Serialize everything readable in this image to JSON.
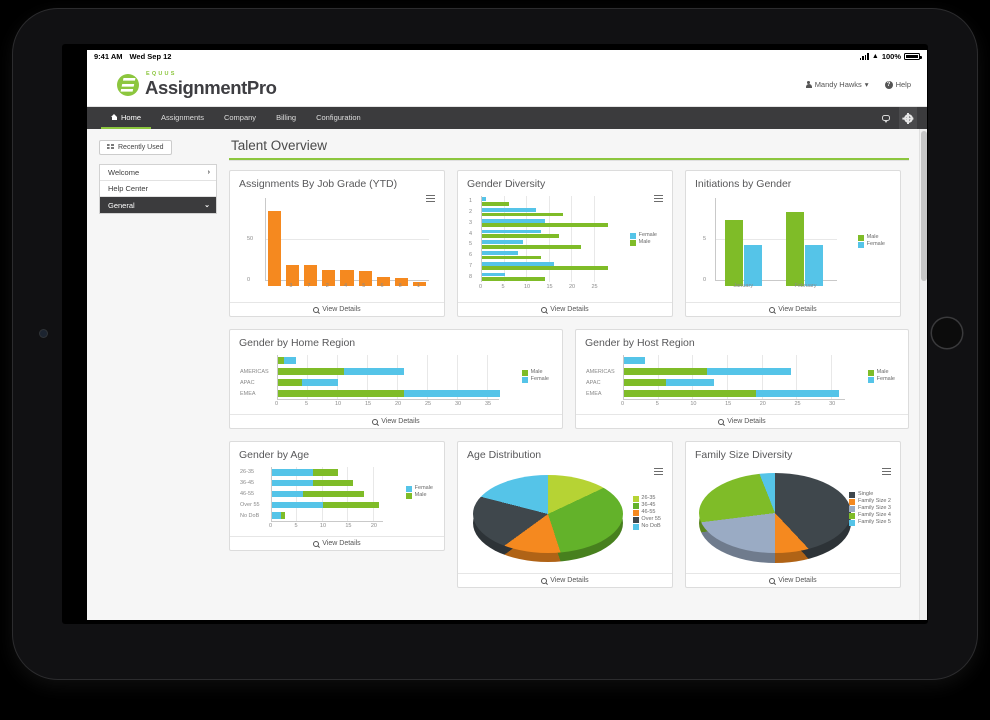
{
  "status_bar": {
    "time": "9:41 AM",
    "date": "Wed Sep 12",
    "battery": "100%"
  },
  "brand": {
    "eyebrow": "EQUUS",
    "name": "AssignmentPro"
  },
  "header": {
    "user": "Mandy Hawks",
    "user_caret": "▾",
    "help": "Help",
    "help_glyph": "?"
  },
  "nav": {
    "items": [
      {
        "label": "Home",
        "active": true
      },
      {
        "label": "Assignments",
        "active": false
      },
      {
        "label": "Company",
        "active": false
      },
      {
        "label": "Billing",
        "active": false
      },
      {
        "label": "Configuration",
        "active": false
      }
    ]
  },
  "sidebar": {
    "recently_used": "Recently Used",
    "items": [
      {
        "label": "Welcome",
        "caret": "›",
        "active": false
      },
      {
        "label": "Help Center",
        "caret": "",
        "active": false
      },
      {
        "label": "General",
        "caret": "⌄",
        "active": true
      }
    ]
  },
  "main": {
    "page_title": "Talent Overview",
    "view_details": "View Details"
  },
  "colors": {
    "green": "#7fbc28",
    "blue": "#55c4e8",
    "orange": "#f5891f",
    "yellow_green": "#b6d334",
    "dark_slate": "#3f474c",
    "steel": "#9aabc4",
    "accent": "#8cc63e",
    "nav_bar": "#3b3b3d"
  },
  "chart_data": [
    {
      "id": "assignments_by_job_grade",
      "type": "bar",
      "title": "Assignments By Job Grade (YTD)",
      "categories": [
        "",
        "3",
        "7",
        "2",
        "4",
        "5",
        "6",
        "8",
        "1"
      ],
      "values": [
        92,
        26,
        26,
        20,
        20,
        18,
        11,
        10,
        5
      ],
      "ylim": [
        0,
        100
      ],
      "yticks": [
        0,
        50
      ],
      "ytick_labels": [
        "0",
        "50"
      ],
      "color": "#f5891f",
      "grid": true
    },
    {
      "id": "gender_diversity",
      "type": "bar",
      "orientation": "horizontal",
      "title": "Gender Diversity",
      "categories": [
        "1",
        "2",
        "3",
        "4",
        "5",
        "6",
        "7",
        "8"
      ],
      "series": [
        {
          "name": "Female",
          "color": "#55c4e8",
          "values": [
            0.8,
            12,
            14,
            13,
            9,
            8,
            16,
            5
          ]
        },
        {
          "name": "Male",
          "color": "#7fbc28",
          "values": [
            6,
            18,
            28,
            17,
            22,
            13,
            28,
            14
          ]
        }
      ],
      "xlim": [
        0,
        28
      ],
      "xticks": [
        0,
        5,
        10,
        15,
        20,
        25
      ],
      "legend_position": "right"
    },
    {
      "id": "initiations_by_gender",
      "type": "bar",
      "title": "Initiations by Gender",
      "categories": [
        "January",
        "February"
      ],
      "series": [
        {
          "name": "Male",
          "color": "#7fbc28",
          "values": [
            8,
            9
          ]
        },
        {
          "name": "Female",
          "color": "#55c4e8",
          "values": [
            5,
            5
          ]
        }
      ],
      "ylim": [
        0,
        10
      ],
      "yticks": [
        0,
        5
      ],
      "ytick_labels": [
        "0",
        "5"
      ],
      "legend_position": "right"
    },
    {
      "id": "gender_by_home_region",
      "type": "bar",
      "orientation": "horizontal",
      "stacked": true,
      "title": "Gender by Home Region",
      "categories": [
        "",
        "AMERICAS",
        "APAC",
        "EMEA"
      ],
      "series": [
        {
          "name": "Male",
          "color": "#7fbc28",
          "values": [
            1,
            11,
            4,
            21
          ]
        },
        {
          "name": "Female",
          "color": "#55c4e8",
          "values": [
            2,
            10,
            6,
            16
          ]
        }
      ],
      "xlim": [
        0,
        37
      ],
      "xticks": [
        0,
        5,
        10,
        15,
        20,
        25,
        30,
        35
      ],
      "legend_position": "right"
    },
    {
      "id": "gender_by_host_region",
      "type": "bar",
      "orientation": "horizontal",
      "stacked": true,
      "title": "Gender by Host Region",
      "categories": [
        "",
        "AMERICAS",
        "APAC",
        "EMEA"
      ],
      "series": [
        {
          "name": "Male",
          "color": "#7fbc28",
          "values": [
            0,
            12,
            6,
            19
          ]
        },
        {
          "name": "Female",
          "color": "#55c4e8",
          "values": [
            3,
            12,
            7,
            12
          ]
        }
      ],
      "xlim": [
        0,
        32
      ],
      "xticks": [
        0,
        5,
        10,
        15,
        20,
        25,
        30
      ],
      "legend_position": "right"
    },
    {
      "id": "gender_by_age",
      "type": "bar",
      "orientation": "horizontal",
      "stacked": true,
      "title": "Gender by Age",
      "categories": [
        "26-35",
        "36-45",
        "46-55",
        "Over 55",
        "No DoB"
      ],
      "series": [
        {
          "name": "Female",
          "color": "#55c4e8",
          "values": [
            8,
            8,
            6,
            10,
            1.8
          ]
        },
        {
          "name": "Male",
          "color": "#7fbc28",
          "values": [
            5,
            8,
            12,
            11,
            0.7
          ]
        }
      ],
      "xlim": [
        0,
        22
      ],
      "xticks": [
        0,
        5,
        10,
        15,
        20
      ],
      "legend_position": "right"
    },
    {
      "id": "age_distribution",
      "type": "pie",
      "title": "Age Distribution",
      "labels": [
        "26-35",
        "36-45",
        "46-55",
        "Over 55",
        "No DoB"
      ],
      "values": [
        18,
        27,
        20,
        14,
        21
      ],
      "colors": [
        "#b6d334",
        "#63b22a",
        "#f5891f",
        "#3f474c",
        "#55c4e8"
      ],
      "legend_position": "right"
    },
    {
      "id": "family_size_diversity",
      "type": "pie",
      "title": "Family Size Diversity",
      "labels": [
        "Single",
        "Family Size 2",
        "Family Size 3",
        "Family Size 4",
        "Family Size 5"
      ],
      "values": [
        38,
        12,
        23,
        21,
        6
      ],
      "colors": [
        "#3f474c",
        "#f5891f",
        "#9aabc4",
        "#7fbc28",
        "#55c4e8"
      ],
      "legend_position": "right"
    }
  ]
}
